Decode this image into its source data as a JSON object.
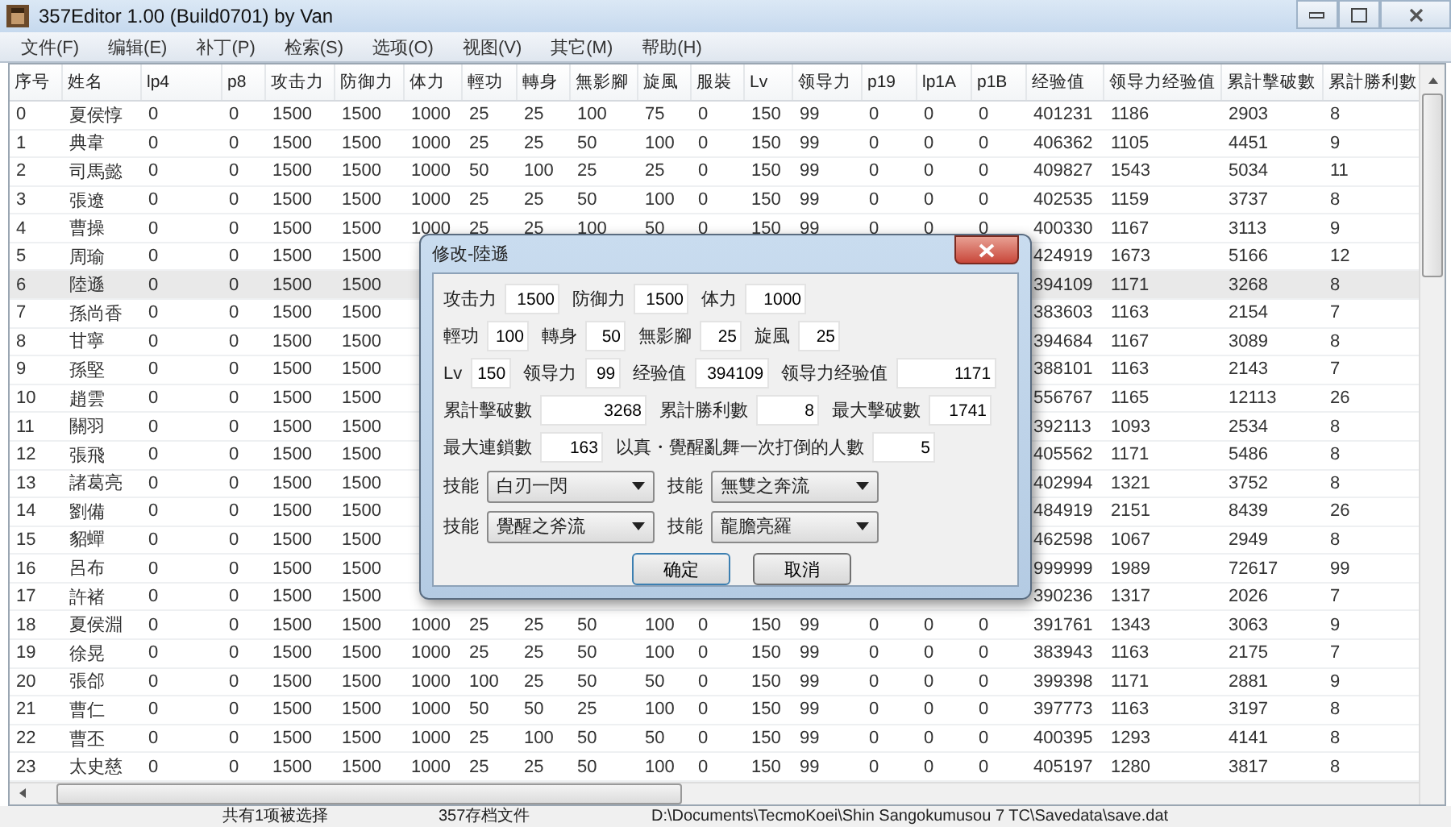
{
  "window": {
    "title": "357Editor 1.00 (Build0701) by Van"
  },
  "menu": [
    "文件(F)",
    "编辑(E)",
    "补丁(P)",
    "检索(S)",
    "选项(O)",
    "视图(V)",
    "其它(M)",
    "帮助(H)"
  ],
  "table": {
    "columns": [
      "序号",
      "姓名",
      "lp4",
      "p8",
      "攻击力",
      "防御力",
      "体力",
      "輕功",
      "轉身",
      "無影腳",
      "旋風",
      "服裝",
      "Lv",
      "领导力",
      "p19",
      "lp1A",
      "p1B",
      "经验值",
      "领导力经验值",
      "累計擊破數",
      "累計勝利數"
    ],
    "rows": [
      {
        "selected": false,
        "cells": [
          "0",
          "夏侯惇",
          "0",
          "0",
          "1500",
          "1500",
          "1000",
          "25",
          "25",
          "100",
          "75",
          "0",
          "150",
          "99",
          "0",
          "0",
          "0",
          "401231",
          "1186",
          "2903",
          "8"
        ]
      },
      {
        "selected": false,
        "cells": [
          "1",
          "典韋",
          "0",
          "0",
          "1500",
          "1500",
          "1000",
          "25",
          "25",
          "50",
          "100",
          "0",
          "150",
          "99",
          "0",
          "0",
          "0",
          "406362",
          "1105",
          "4451",
          "9"
        ]
      },
      {
        "selected": false,
        "cells": [
          "2",
          "司馬懿",
          "0",
          "0",
          "1500",
          "1500",
          "1000",
          "50",
          "100",
          "25",
          "25",
          "0",
          "150",
          "99",
          "0",
          "0",
          "0",
          "409827",
          "1543",
          "5034",
          "11"
        ]
      },
      {
        "selected": false,
        "cells": [
          "3",
          "張遼",
          "0",
          "0",
          "1500",
          "1500",
          "1000",
          "25",
          "25",
          "50",
          "100",
          "0",
          "150",
          "99",
          "0",
          "0",
          "0",
          "402535",
          "1159",
          "3737",
          "8"
        ]
      },
      {
        "selected": false,
        "cells": [
          "4",
          "曹操",
          "0",
          "0",
          "1500",
          "1500",
          "1000",
          "25",
          "25",
          "100",
          "50",
          "0",
          "150",
          "99",
          "0",
          "0",
          "0",
          "400330",
          "1167",
          "3113",
          "9"
        ]
      },
      {
        "selected": false,
        "cells": [
          "5",
          "周瑜",
          "0",
          "0",
          "1500",
          "1500",
          null,
          null,
          null,
          null,
          null,
          null,
          null,
          null,
          null,
          null,
          null,
          "424919",
          "1673",
          "5166",
          "12"
        ]
      },
      {
        "selected": true,
        "cells": [
          "6",
          "陸遜",
          "0",
          "0",
          "1500",
          "1500",
          null,
          null,
          null,
          null,
          null,
          null,
          null,
          null,
          null,
          null,
          null,
          "394109",
          "1171",
          "3268",
          "8"
        ]
      },
      {
        "selected": false,
        "cells": [
          "7",
          "孫尚香",
          "0",
          "0",
          "1500",
          "1500",
          null,
          null,
          null,
          null,
          null,
          null,
          null,
          null,
          null,
          null,
          null,
          "383603",
          "1163",
          "2154",
          "7"
        ]
      },
      {
        "selected": false,
        "cells": [
          "8",
          "甘寧",
          "0",
          "0",
          "1500",
          "1500",
          null,
          null,
          null,
          null,
          null,
          null,
          null,
          null,
          null,
          null,
          null,
          "394684",
          "1167",
          "3089",
          "8"
        ]
      },
      {
        "selected": false,
        "cells": [
          "9",
          "孫堅",
          "0",
          "0",
          "1500",
          "1500",
          null,
          null,
          null,
          null,
          null,
          null,
          null,
          null,
          null,
          null,
          null,
          "388101",
          "1163",
          "2143",
          "7"
        ]
      },
      {
        "selected": false,
        "cells": [
          "10",
          "趙雲",
          "0",
          "0",
          "1500",
          "1500",
          null,
          null,
          null,
          null,
          null,
          null,
          null,
          null,
          null,
          null,
          null,
          "556767",
          "1165",
          "12113",
          "26"
        ]
      },
      {
        "selected": false,
        "cells": [
          "11",
          "關羽",
          "0",
          "0",
          "1500",
          "1500",
          null,
          null,
          null,
          null,
          null,
          null,
          null,
          null,
          null,
          null,
          null,
          "392113",
          "1093",
          "2534",
          "8"
        ]
      },
      {
        "selected": false,
        "cells": [
          "12",
          "張飛",
          "0",
          "0",
          "1500",
          "1500",
          null,
          null,
          null,
          null,
          null,
          null,
          null,
          null,
          null,
          null,
          null,
          "405562",
          "1171",
          "5486",
          "8"
        ]
      },
      {
        "selected": false,
        "cells": [
          "13",
          "諸葛亮",
          "0",
          "0",
          "1500",
          "1500",
          null,
          null,
          null,
          null,
          null,
          null,
          null,
          null,
          null,
          null,
          null,
          "402994",
          "1321",
          "3752",
          "8"
        ]
      },
      {
        "selected": false,
        "cells": [
          "14",
          "劉備",
          "0",
          "0",
          "1500",
          "1500",
          null,
          null,
          null,
          null,
          null,
          null,
          null,
          null,
          null,
          null,
          null,
          "484919",
          "2151",
          "8439",
          "26"
        ]
      },
      {
        "selected": false,
        "cells": [
          "15",
          "貂蟬",
          "0",
          "0",
          "1500",
          "1500",
          null,
          null,
          null,
          null,
          null,
          null,
          null,
          null,
          null,
          null,
          null,
          "462598",
          "1067",
          "2949",
          "8"
        ]
      },
      {
        "selected": false,
        "cells": [
          "16",
          "呂布",
          "0",
          "0",
          "1500",
          "1500",
          null,
          null,
          null,
          null,
          null,
          null,
          null,
          null,
          null,
          null,
          null,
          "999999",
          "1989",
          "72617",
          "99"
        ]
      },
      {
        "selected": false,
        "cells": [
          "17",
          "許褚",
          "0",
          "0",
          "1500",
          "1500",
          null,
          null,
          null,
          null,
          null,
          null,
          null,
          null,
          null,
          null,
          null,
          "390236",
          "1317",
          "2026",
          "7"
        ]
      },
      {
        "selected": false,
        "cells": [
          "18",
          "夏侯淵",
          "0",
          "0",
          "1500",
          "1500",
          "1000",
          "25",
          "25",
          "50",
          "100",
          "0",
          "150",
          "99",
          "0",
          "0",
          "0",
          "391761",
          "1343",
          "3063",
          "9"
        ]
      },
      {
        "selected": false,
        "cells": [
          "19",
          "徐晃",
          "0",
          "0",
          "1500",
          "1500",
          "1000",
          "25",
          "25",
          "50",
          "100",
          "0",
          "150",
          "99",
          "0",
          "0",
          "0",
          "383943",
          "1163",
          "2175",
          "7"
        ]
      },
      {
        "selected": false,
        "cells": [
          "20",
          "張郃",
          "0",
          "0",
          "1500",
          "1500",
          "1000",
          "100",
          "25",
          "50",
          "50",
          "0",
          "150",
          "99",
          "0",
          "0",
          "0",
          "399398",
          "1171",
          "2881",
          "9"
        ]
      },
      {
        "selected": false,
        "cells": [
          "21",
          "曹仁",
          "0",
          "0",
          "1500",
          "1500",
          "1000",
          "50",
          "50",
          "25",
          "100",
          "0",
          "150",
          "99",
          "0",
          "0",
          "0",
          "397773",
          "1163",
          "3197",
          "8"
        ]
      },
      {
        "selected": false,
        "cells": [
          "22",
          "曹丕",
          "0",
          "0",
          "1500",
          "1500",
          "1000",
          "25",
          "100",
          "50",
          "50",
          "0",
          "150",
          "99",
          "0",
          "0",
          "0",
          "400395",
          "1293",
          "4141",
          "8"
        ]
      },
      {
        "selected": false,
        "cells": [
          "23",
          "太史慈",
          "0",
          "0",
          "1500",
          "1500",
          "1000",
          "25",
          "25",
          "50",
          "100",
          "0",
          "150",
          "99",
          "0",
          "0",
          "0",
          "405197",
          "1280",
          "3817",
          "8"
        ]
      }
    ]
  },
  "dialog": {
    "title": "修改-陸遜",
    "fields": [
      [
        {
          "label": "攻击力",
          "value": "1500"
        },
        {
          "label": "防御力",
          "value": "1500"
        },
        {
          "label": "体力",
          "value": "1000"
        }
      ],
      [
        {
          "label": "輕功",
          "value": "100"
        },
        {
          "label": "轉身",
          "value": "50"
        },
        {
          "label": "無影腳",
          "value": "25"
        },
        {
          "label": "旋風",
          "value": "25"
        }
      ],
      [
        {
          "label": "Lv",
          "value": "150"
        },
        {
          "label": "领导力",
          "value": "99"
        },
        {
          "label": "经验值",
          "value": "394109"
        },
        {
          "label": "领导力经验值",
          "value": "1171"
        }
      ],
      [
        {
          "label": "累計擊破數",
          "value": "3268"
        },
        {
          "label": "累計勝利數",
          "value": "8"
        },
        {
          "label": "最大擊破數",
          "value": "1741"
        }
      ],
      [
        {
          "label": "最大連鎖數",
          "value": "163"
        },
        {
          "label": "以真・覺醒亂舞一次打倒的人數",
          "value": "5"
        }
      ]
    ],
    "skills": [
      [
        {
          "label": "技能",
          "value": "白刃一閃"
        },
        {
          "label": "技能",
          "value": "無雙之奔流"
        }
      ],
      [
        {
          "label": "技能",
          "value": "覺醒之斧流"
        },
        {
          "label": "技能",
          "value": "龍膽亮羅"
        }
      ]
    ],
    "buttons": [
      "确定",
      "取消"
    ]
  },
  "status_bar": [
    "共有1项被选择",
    "357存档文件",
    "D:\\Documents\\TecmoKoei\\Shin Sangokumusou 7 TC\\Savedata\\save.dat"
  ]
}
